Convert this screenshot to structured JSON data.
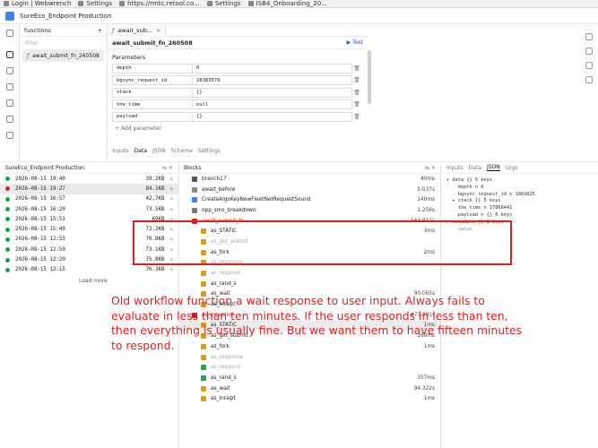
{
  "bookmarks": [
    "Login | Webwrench",
    "Settings",
    "https://rmtc.retool.co...",
    "Settings",
    "ISB4_Onboarding_20..."
  ],
  "app_title": "SureEco_Endpoint Production",
  "functions_panel": {
    "title": "functions",
    "filter_placeholder": "Filter",
    "selected": "await_submit_fn_260508"
  },
  "editor": {
    "tab_label": "await_sub...",
    "fn_name": "await_submit_fn_260508",
    "test_label": "Test",
    "params_title": "Parameters",
    "params": [
      {
        "key": "depth",
        "value": "0"
      },
      {
        "key": "bgsync_request_id",
        "value": "18383579"
      },
      {
        "key": "stack",
        "value": "{}"
      },
      {
        "key": "the_time",
        "value": "null"
      },
      {
        "key": "payload",
        "value": "{}"
      }
    ],
    "add_param": "+ Add parameter",
    "bottom_tabs": [
      "Inputs",
      "Data",
      "JSON",
      "Schema",
      "Settings"
    ]
  },
  "history": {
    "title": "SureEco_Endpoint Production",
    "rows": [
      {
        "time": "2026-08-15 19:40",
        "size": "39.2KB",
        "status": "green"
      },
      {
        "time": "2026-08-15 19:27",
        "size": "84.1KB",
        "status": "red"
      },
      {
        "time": "2026-08-15 16:57",
        "size": "42.7KB",
        "status": "green"
      },
      {
        "time": "2026-08-15 16:20",
        "size": "73.5KB",
        "status": "green"
      },
      {
        "time": "2026-08-15 15:51",
        "size": "69KB",
        "status": "green"
      },
      {
        "time": "2026-08-15 15:49",
        "size": "72.2KB",
        "status": "green"
      },
      {
        "time": "2026-08-15 12:53",
        "size": "70.8KB",
        "status": "green"
      },
      {
        "time": "2026-08-15 12:50",
        "size": "73.1KB",
        "status": "green"
      },
      {
        "time": "2026-08-15 12:20",
        "size": "75.8KB",
        "status": "green"
      },
      {
        "time": "2026-08-15 12:15",
        "size": "76.3KB",
        "status": "green"
      }
    ],
    "load_more": "Load more"
  },
  "blocks": {
    "title": "Blocks",
    "rows": [
      {
        "name": "branch17",
        "dur": "40ms",
        "indent": 1,
        "style": "normal",
        "icon": "#555"
      },
      {
        "name": "await_before",
        "dur": "5.037s",
        "indent": 1,
        "style": "normal",
        "icon": "#888"
      },
      {
        "name": "CreateAlgoKeyNewFleetNetRequestSound",
        "dur": "140ms",
        "indent": 1,
        "style": "normal",
        "icon": "#3b82f6"
      },
      {
        "name": "opp_sms_breakdown",
        "dur": "1.256s",
        "indent": 1,
        "style": "normal",
        "icon": "#777"
      },
      {
        "name": "await_submit_fn",
        "dur": "564.811s",
        "indent": 1,
        "style": "red",
        "icon": "#c81e1e"
      },
      {
        "name": "as_STATIC",
        "dur": "3ms",
        "indent": 2,
        "style": "normal",
        "icon": "#d4a017"
      },
      {
        "name": "as_get_submit",
        "dur": "",
        "indent": 2,
        "style": "grey",
        "icon": "#d4a017"
      },
      {
        "name": "as_fork",
        "dur": "2ms",
        "indent": 2,
        "style": "normal",
        "icon": "#d4a017"
      },
      {
        "name": "as_response",
        "dur": "",
        "indent": 2,
        "style": "grey",
        "icon": "#d4a017"
      },
      {
        "name": "as_respond",
        "dur": "",
        "indent": 2,
        "style": "grey",
        "icon": "#d4a017"
      },
      {
        "name": "as_rand_s",
        "dur": "",
        "indent": 2,
        "style": "normal",
        "icon": "#d4a017"
      },
      {
        "name": "as_wait",
        "dur": "90.065s",
        "indent": 2,
        "style": "normal",
        "icon": "#d4a017"
      },
      {
        "name": "as_incept",
        "dur": "",
        "indent": 2,
        "style": "normal",
        "icon": "#d4a017"
      },
      {
        "name": "as_inception",
        "dur": "473.991s",
        "indent": 1,
        "style": "red",
        "icon": "#c81e1e"
      },
      {
        "name": "as_STATIC",
        "dur": "1ms",
        "indent": 2,
        "style": "normal",
        "icon": "#d4a017"
      },
      {
        "name": "as_get_submit",
        "dur": "168ms",
        "indent": 2,
        "style": "normal",
        "icon": "#d4a017"
      },
      {
        "name": "as_fork",
        "dur": "1ms",
        "indent": 2,
        "style": "normal",
        "icon": "#d4a017"
      },
      {
        "name": "as_response",
        "dur": "",
        "indent": 2,
        "style": "grey",
        "icon": "#d4a017"
      },
      {
        "name": "as_respond",
        "dur": "",
        "indent": 2,
        "style": "grey",
        "icon": "#2aa64a"
      },
      {
        "name": "as_rand_s",
        "dur": "357ms",
        "indent": 2,
        "style": "normal",
        "icon": "#2aa64a"
      },
      {
        "name": "as_wait",
        "dur": "94.322s",
        "indent": 2,
        "style": "normal",
        "icon": "#d4a017"
      },
      {
        "name": "as_incept",
        "dur": "1ms",
        "indent": 2,
        "style": "normal",
        "icon": "#d4a017"
      }
    ]
  },
  "inspector": {
    "tabs": [
      "Inputs",
      "Data",
      "JSON",
      "Logs"
    ],
    "active": "JSON",
    "lines": [
      {
        "t": "▾ data {} 5 keys",
        "c": "jk"
      },
      {
        "t": "    depth n 6",
        "c": "jk"
      },
      {
        "t": "    bgsync_request_id n 1869825",
        "c": "jk"
      },
      {
        "t": "  ▸ stack {} 5 keys",
        "c": "jk"
      },
      {
        "t": "    the_time n 17866441",
        "c": "jk"
      },
      {
        "t": "    payload n {} 0 keys",
        "c": "jk"
      },
      {
        "t": "▸ metadata {} 3 keys",
        "c": "jk"
      },
      {
        "t": "    value",
        "c": "jm"
      }
    ]
  },
  "annotation": "Old workflow function a wait response to user input. Always fails to evaluate in less than ten minutes. If the user responds in less than ten, then everything is usually fine. But we want them to have fifteen minutes to respond.",
  "colors": {
    "annotation": "#e11d1d",
    "success": "#16a34a",
    "error": "#dc2626"
  }
}
